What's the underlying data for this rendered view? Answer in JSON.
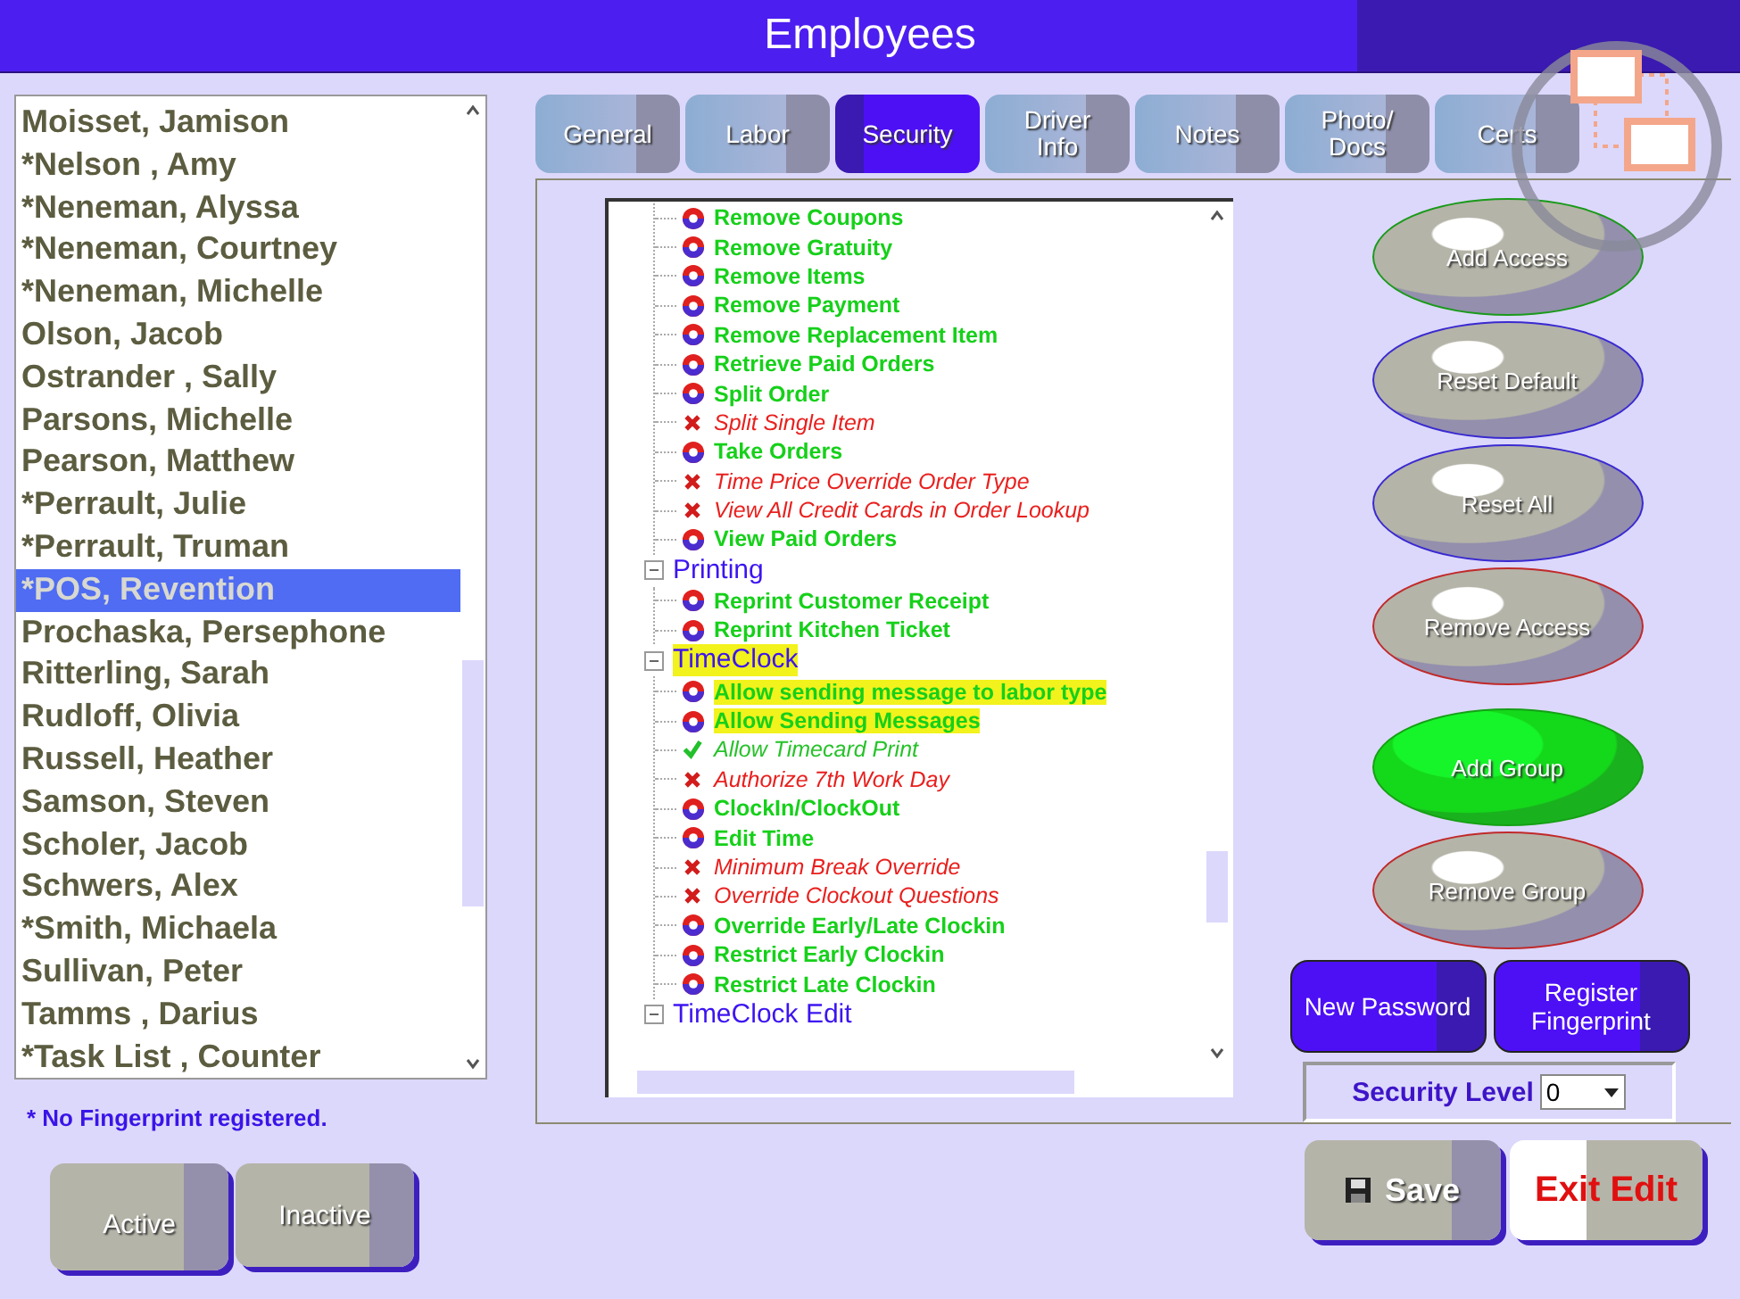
{
  "window": {
    "title": "Employees"
  },
  "employees": [
    {
      "name": "Moisset, Jamison",
      "selected": false
    },
    {
      "name": "*Nelson , Amy",
      "selected": false
    },
    {
      "name": "*Neneman, Alyssa",
      "selected": false
    },
    {
      "name": "*Neneman, Courtney",
      "selected": false
    },
    {
      "name": "*Neneman, Michelle",
      "selected": false
    },
    {
      "name": "Olson, Jacob",
      "selected": false
    },
    {
      "name": "Ostrander , Sally",
      "selected": false
    },
    {
      "name": "Parsons, Michelle",
      "selected": false
    },
    {
      "name": "Pearson, Matthew",
      "selected": false
    },
    {
      "name": "*Perrault, Julie",
      "selected": false
    },
    {
      "name": "*Perrault, Truman",
      "selected": false
    },
    {
      "name": "*POS, Revention",
      "selected": true
    },
    {
      "name": "Prochaska, Persephone",
      "selected": false
    },
    {
      "name": "Ritterling, Sarah",
      "selected": false
    },
    {
      "name": "Rudloff, Olivia",
      "selected": false
    },
    {
      "name": "Russell, Heather",
      "selected": false
    },
    {
      "name": "Samson,  Steven",
      "selected": false
    },
    {
      "name": "Scholer, Jacob",
      "selected": false
    },
    {
      "name": "Schwers, Alex",
      "selected": false
    },
    {
      "name": "*Smith, Michaela",
      "selected": false
    },
    {
      "name": "Sullivan, Peter",
      "selected": false
    },
    {
      "name": "Tamms , Darius",
      "selected": false
    },
    {
      "name": "*Task List , Counter",
      "selected": false
    }
  ],
  "footnote": "* No Fingerprint registered.",
  "status_buttons": [
    "Active",
    "Inactive"
  ],
  "tabs": [
    {
      "label": "General",
      "selected": false
    },
    {
      "label": "Labor",
      "selected": false
    },
    {
      "label": "Security",
      "selected": true
    },
    {
      "label": "Driver\nInfo",
      "selected": false
    },
    {
      "label": "Notes",
      "selected": false
    },
    {
      "label": "Photo/\nDocs",
      "selected": false
    },
    {
      "label": "Certs",
      "selected": false
    }
  ],
  "tree": [
    {
      "children": [
        {
          "label": "Remove Coupons",
          "kind": "access",
          "highlighted": false
        },
        {
          "label": "Remove Gratuity",
          "kind": "access",
          "highlighted": false
        },
        {
          "label": "Remove Items",
          "kind": "access",
          "highlighted": false
        },
        {
          "label": "Remove Payment",
          "kind": "access",
          "highlighted": false
        },
        {
          "label": "Remove Replacement Item",
          "kind": "access",
          "highlighted": false
        },
        {
          "label": "Retrieve Paid Orders",
          "kind": "access",
          "highlighted": false
        },
        {
          "label": "Split Order",
          "kind": "access",
          "highlighted": false
        },
        {
          "label": "Split Single Item",
          "kind": "denied",
          "highlighted": false
        },
        {
          "label": "Take Orders",
          "kind": "access",
          "highlighted": false
        },
        {
          "label": "Time Price Override Order Type",
          "kind": "denied",
          "highlighted": false
        },
        {
          "label": "View All Credit Cards in Order Lookup",
          "kind": "denied",
          "highlighted": false
        },
        {
          "label": "View Paid Orders",
          "kind": "access",
          "highlighted": false
        }
      ]
    },
    {
      "label": "Printing",
      "expanded": true,
      "highlighted": false,
      "children": [
        {
          "label": "Reprint Customer Receipt",
          "kind": "access",
          "highlighted": false
        },
        {
          "label": "Reprint Kitchen Ticket",
          "kind": "access",
          "highlighted": false
        }
      ]
    },
    {
      "label": "TimeClock",
      "expanded": true,
      "highlighted": true,
      "children": [
        {
          "label": "Allow sending message to labor type",
          "kind": "access",
          "highlighted": true
        },
        {
          "label": "Allow Sending Messages",
          "kind": "access",
          "highlighted": true
        },
        {
          "label": "Allow Timecard Print",
          "kind": "allowed",
          "highlighted": false
        },
        {
          "label": "Authorize 7th Work Day",
          "kind": "denied",
          "highlighted": false
        },
        {
          "label": "ClockIn/ClockOut",
          "kind": "access",
          "highlighted": false
        },
        {
          "label": "Edit Time",
          "kind": "access",
          "highlighted": false
        },
        {
          "label": "Minimum Break Override",
          "kind": "denied",
          "highlighted": false
        },
        {
          "label": "Override Clockout Questions",
          "kind": "denied",
          "highlighted": false
        },
        {
          "label": "Override Early/Late Clockin",
          "kind": "access",
          "highlighted": false
        },
        {
          "label": "Restrict Early Clockin",
          "kind": "access",
          "highlighted": false
        },
        {
          "label": "Restrict Late Clockin",
          "kind": "access",
          "highlighted": false
        }
      ]
    },
    {
      "label": "TimeClock Edit",
      "expanded": true,
      "highlighted": false
    }
  ],
  "action_buttons": [
    {
      "label": "Add Access",
      "kind": "green-ring"
    },
    {
      "label": "Reset Default",
      "kind": "blue-ring"
    },
    {
      "label": "Reset All",
      "kind": "blue-ring"
    },
    {
      "label": "Remove Access",
      "kind": "red-ring"
    },
    {
      "label": "Add Group",
      "kind": "filled"
    },
    {
      "label": "Remove Group",
      "kind": "red-ring"
    }
  ],
  "password_buttons": [
    "New Password",
    "Register\nFingerprint"
  ],
  "security_level": {
    "label": "Security Level",
    "value": "0"
  },
  "save_button": "Save",
  "exit_button": "Exit Edit"
}
